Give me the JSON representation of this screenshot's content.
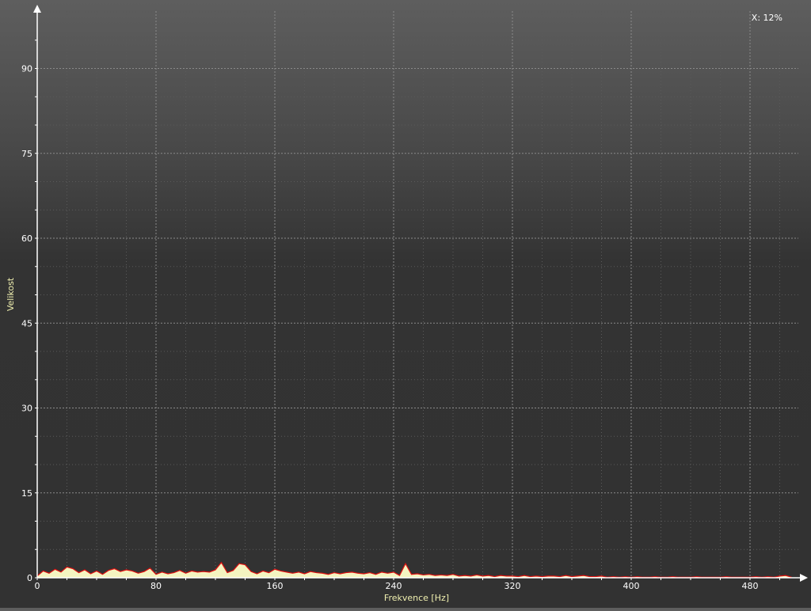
{
  "readout": {
    "label": "X:",
    "value": "12%"
  },
  "chart_data": {
    "type": "area",
    "title": "",
    "xlabel": "Frekvence [Hz]",
    "ylabel": "Velikost",
    "xlim": [
      0,
      512
    ],
    "ylim": [
      0,
      100
    ],
    "x_ticks": [
      0,
      80,
      160,
      240,
      320,
      400,
      480
    ],
    "y_ticks": [
      0,
      15,
      30,
      45,
      60,
      75,
      90
    ],
    "grid": true,
    "legend": "none",
    "colors": {
      "line": "#e01010",
      "fill": "#f4f4c0",
      "label": "#f0f0b0",
      "grid": "#8a8a8a",
      "axis": "#ffffff"
    },
    "x": [
      0,
      4,
      8,
      12,
      16,
      20,
      24,
      28,
      32,
      36,
      40,
      44,
      48,
      52,
      56,
      60,
      64,
      68,
      72,
      76,
      80,
      84,
      88,
      92,
      96,
      100,
      104,
      108,
      112,
      116,
      120,
      124,
      128,
      132,
      136,
      140,
      144,
      148,
      152,
      156,
      160,
      164,
      168,
      172,
      176,
      180,
      184,
      188,
      192,
      196,
      200,
      204,
      208,
      212,
      216,
      220,
      224,
      228,
      232,
      236,
      240,
      244,
      248,
      252,
      256,
      260,
      264,
      268,
      272,
      276,
      280,
      284,
      288,
      292,
      296,
      300,
      304,
      308,
      312,
      316,
      320,
      324,
      328,
      332,
      336,
      340,
      344,
      348,
      352,
      356,
      360,
      364,
      368,
      372,
      376,
      380,
      384,
      388,
      392,
      396,
      400,
      404,
      408,
      412,
      416,
      420,
      424,
      428,
      432,
      436,
      440,
      444,
      448,
      452,
      456,
      460,
      464,
      468,
      472,
      476,
      480,
      484,
      488,
      492,
      496,
      500,
      504,
      508
    ],
    "values": [
      0.3,
      1.2,
      0.8,
      1.5,
      1.0,
      1.9,
      1.6,
      0.9,
      1.4,
      0.7,
      1.2,
      0.6,
      1.3,
      1.6,
      1.1,
      1.4,
      1.2,
      0.8,
      1.1,
      1.7,
      0.6,
      1.0,
      0.7,
      0.9,
      1.3,
      0.8,
      1.2,
      1.0,
      1.1,
      1.0,
      1.4,
      2.7,
      0.9,
      1.3,
      2.5,
      2.3,
      1.1,
      0.7,
      1.2,
      0.9,
      1.5,
      1.2,
      1.0,
      0.8,
      1.0,
      0.7,
      1.1,
      0.9,
      0.8,
      0.6,
      0.9,
      0.7,
      0.9,
      1.0,
      0.8,
      0.7,
      0.9,
      0.6,
      1.0,
      0.8,
      1.0,
      0.4,
      2.5,
      0.6,
      0.7,
      0.5,
      0.6,
      0.4,
      0.5,
      0.4,
      0.6,
      0.3,
      0.4,
      0.3,
      0.5,
      0.3,
      0.4,
      0.2,
      0.4,
      0.3,
      0.3,
      0.2,
      0.4,
      0.2,
      0.3,
      0.2,
      0.3,
      0.3,
      0.2,
      0.4,
      0.2,
      0.3,
      0.4,
      0.2,
      0.2,
      0.3,
      0.1,
      0.2,
      0.1,
      0.2,
      0.1,
      0.2,
      0.1,
      0.1,
      0.2,
      0.1,
      0.1,
      0.2,
      0.1,
      0.1,
      0.1,
      0.2,
      0.1,
      0.1,
      0.1,
      0.1,
      0.2,
      0.1,
      0.1,
      0.1,
      0.1,
      0.2,
      0.1,
      0.2,
      0.1,
      0.3,
      0.4,
      0.1
    ]
  }
}
